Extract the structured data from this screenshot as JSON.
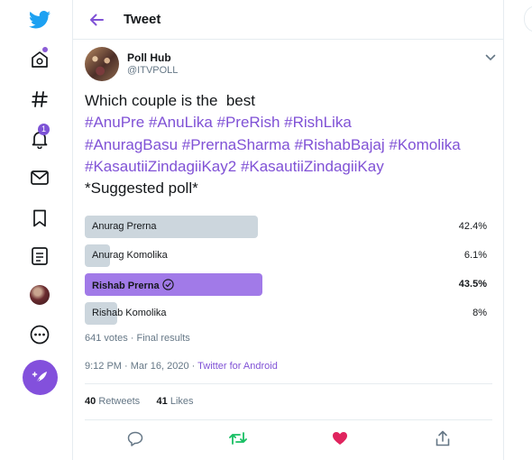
{
  "nav": {
    "items": [
      "twitter-logo",
      "explore",
      "hashtag",
      "notifications",
      "messages",
      "bookmarks",
      "lists",
      "profile",
      "more"
    ],
    "notifications_count": "1"
  },
  "header": {
    "title": "Tweet"
  },
  "tweet": {
    "author_name": "Poll Hub",
    "author_handle": "@ITVPOLL",
    "text_line1": "Which couple is the  best",
    "hashtags_line1": "#AnuPre #AnuLika #PreRish #RishLika",
    "hashtags_line2": "#AnuragBasu #PrernaSharma #RishabBajaj #Komolika",
    "hashtags_line3": "#KasautiiZindagiiKay2 #KasautiiZindagiiKay",
    "text_line_last": "*Suggested poll*",
    "timestamp": "9:12 PM · Mar 16, 2020",
    "separator": "·",
    "source": "Twitter for Android"
  },
  "poll": {
    "options": [
      {
        "label": "Anurag Prerna",
        "percent": "42.4%",
        "value": 42.4,
        "winner": false
      },
      {
        "label": "Anurag Komolika",
        "percent": "6.1%",
        "value": 6.1,
        "winner": false
      },
      {
        "label": "Rishab Prerna",
        "percent": "43.5%",
        "value": 43.5,
        "winner": true
      },
      {
        "label": "Rishab Komolika",
        "percent": "8%",
        "value": 8,
        "winner": false
      }
    ],
    "summary": "641 votes · Final results"
  },
  "stats": {
    "retweets_count": "40",
    "retweets_label": "Retweets",
    "likes_count": "41",
    "likes_label": "Likes"
  },
  "colors": {
    "accent": "#8052d6",
    "winner_bar": "#a17ae8",
    "bar": "#ccd6dd",
    "retweet": "#17bf63",
    "like": "#e0245e"
  }
}
